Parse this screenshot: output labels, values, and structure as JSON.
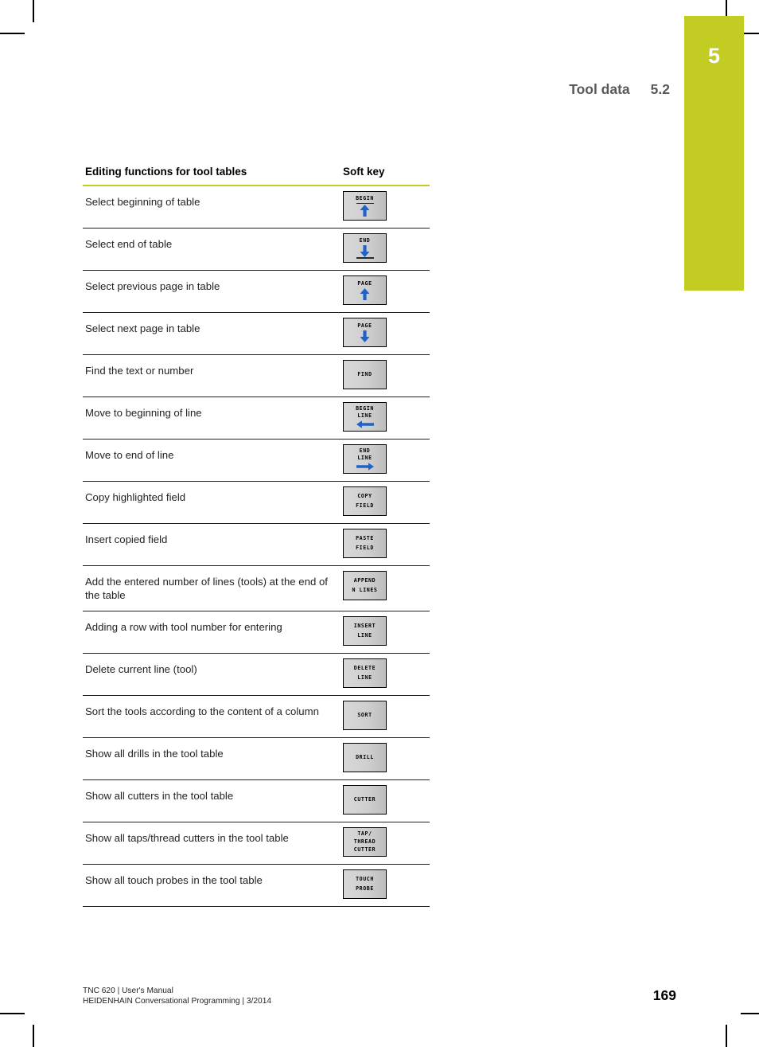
{
  "chapter": {
    "number": "5",
    "tab_color": "#c2cc22"
  },
  "running_head": {
    "title": "Tool data",
    "section": "5.2"
  },
  "table": {
    "header_description": "Editing functions for tool tables",
    "header_softkey": "Soft key",
    "rows": [
      {
        "description": "Select beginning of table",
        "softkey": {
          "name": "begin-softkey",
          "lines": [
            "BEGIN"
          ],
          "rule": "top",
          "arrow": "up"
        }
      },
      {
        "description": "Select end of table",
        "softkey": {
          "name": "end-softkey",
          "lines": [
            "END"
          ],
          "rule": "bottom",
          "arrow": "down"
        }
      },
      {
        "description": "Select previous page in table",
        "softkey": {
          "name": "page-up-softkey",
          "lines": [
            "PAGE"
          ],
          "rule": "none",
          "arrow": "up"
        }
      },
      {
        "description": "Select next page in table",
        "softkey": {
          "name": "page-down-softkey",
          "lines": [
            "PAGE"
          ],
          "rule": "none",
          "arrow": "down"
        }
      },
      {
        "description": "Find the text or number",
        "softkey": {
          "name": "find-softkey",
          "lines": [
            "FIND"
          ],
          "rule": "none",
          "arrow": "none"
        }
      },
      {
        "description": "Move to beginning of line",
        "softkey": {
          "name": "begin-line-softkey",
          "lines": [
            "BEGIN",
            "LINE"
          ],
          "rule": "none",
          "arrow": "left"
        }
      },
      {
        "description": "Move to end of line",
        "softkey": {
          "name": "end-line-softkey",
          "lines": [
            "END",
            "LINE"
          ],
          "rule": "none",
          "arrow": "right"
        }
      },
      {
        "description": "Copy highlighted field",
        "softkey": {
          "name": "copy-field-softkey",
          "lines": [
            "COPY",
            "FIELD"
          ],
          "rule": "none",
          "arrow": "none",
          "spaced": true
        }
      },
      {
        "description": "Insert copied field",
        "softkey": {
          "name": "paste-field-softkey",
          "lines": [
            "PASTE",
            "FIELD"
          ],
          "rule": "none",
          "arrow": "none",
          "spaced": true
        }
      },
      {
        "description": "Add the entered number of lines (tools) at the end of the table",
        "softkey": {
          "name": "append-n-lines-softkey",
          "lines": [
            "APPEND",
            "N LINES"
          ],
          "rule": "none",
          "arrow": "none",
          "spaced": true
        }
      },
      {
        "description": "Adding a row with tool number for entering",
        "softkey": {
          "name": "insert-line-softkey",
          "lines": [
            "INSERT",
            "LINE"
          ],
          "rule": "none",
          "arrow": "none",
          "spaced": true
        }
      },
      {
        "description": "Delete current line (tool)",
        "softkey": {
          "name": "delete-line-softkey",
          "lines": [
            "DELETE",
            "LINE"
          ],
          "rule": "none",
          "arrow": "none",
          "spaced": true
        }
      },
      {
        "description": "Sort the tools according to the content of a column",
        "softkey": {
          "name": "sort-softkey",
          "lines": [
            "SORT"
          ],
          "rule": "none",
          "arrow": "none"
        }
      },
      {
        "description": "Show all drills in the tool table",
        "softkey": {
          "name": "drill-softkey",
          "lines": [
            "DRILL"
          ],
          "rule": "none",
          "arrow": "none"
        }
      },
      {
        "description": "Show all cutters in the tool table",
        "softkey": {
          "name": "cutter-softkey",
          "lines": [
            "CUTTER"
          ],
          "rule": "none",
          "arrow": "none"
        }
      },
      {
        "description": "Show all taps/thread cutters in the tool table",
        "softkey": {
          "name": "tap-thread-cutter-softkey",
          "lines": [
            "TAP/",
            "THREAD",
            "CUTTER"
          ],
          "rule": "none",
          "arrow": "none"
        }
      },
      {
        "description": "Show all touch probes in the tool table",
        "softkey": {
          "name": "touch-probe-softkey",
          "lines": [
            "TOUCH",
            "PROBE"
          ],
          "rule": "none",
          "arrow": "none",
          "spaced": true
        }
      }
    ]
  },
  "footer": {
    "line1": "TNC 620 | User's Manual",
    "line2": "HEIDENHAIN Conversational Programming | 3/2014",
    "page_number": "169"
  }
}
